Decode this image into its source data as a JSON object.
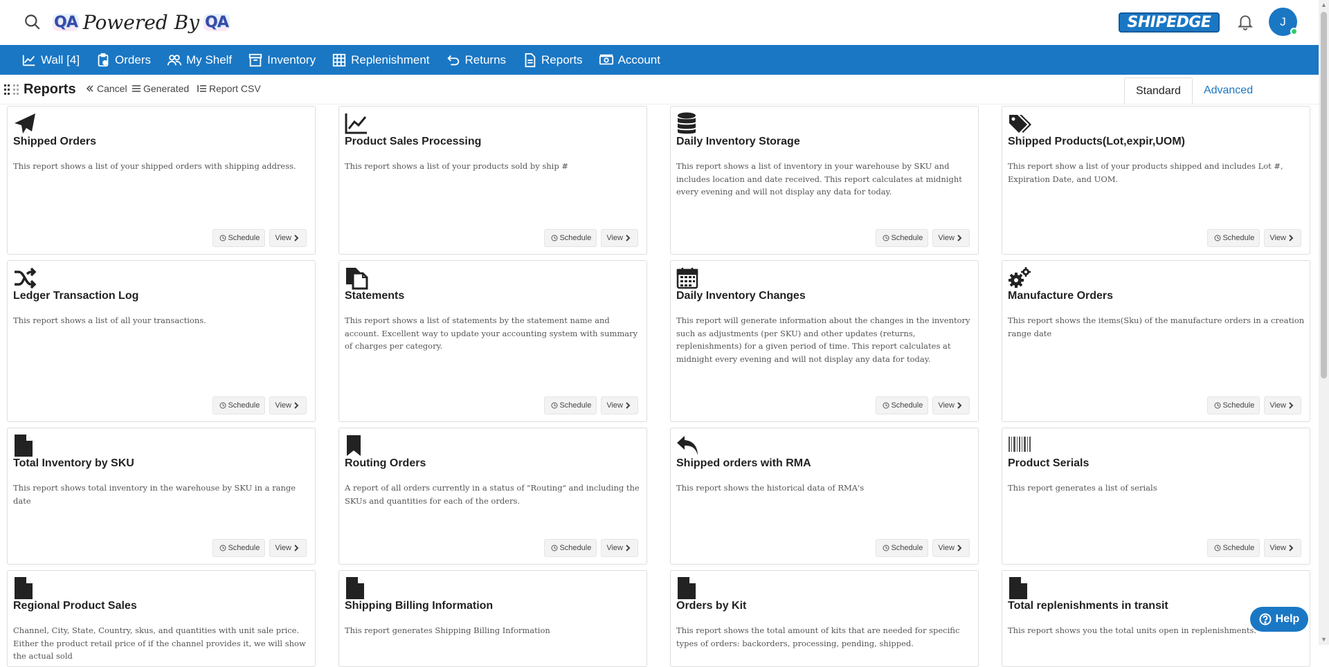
{
  "header": {
    "brand_left": "QA",
    "brand_middle": "Powered By",
    "brand_right": "QA",
    "logo_text": "SHIPEDGE",
    "avatar_initial": "J"
  },
  "nav": [
    {
      "label": "Wall [4]",
      "icon": "chart-line-icon"
    },
    {
      "label": "Orders",
      "icon": "clipboard-icon"
    },
    {
      "label": "My Shelf",
      "icon": "users-icon"
    },
    {
      "label": "Inventory",
      "icon": "archive-box-icon"
    },
    {
      "label": "Replenishment",
      "icon": "grid-icon"
    },
    {
      "label": "Returns",
      "icon": "undo-icon"
    },
    {
      "label": "Reports",
      "icon": "document-icon"
    },
    {
      "label": "Account",
      "icon": "money-icon"
    }
  ],
  "subheader": {
    "title": "Reports",
    "cancel": "Cancel",
    "generated": "Generated",
    "report_csv": "Report CSV",
    "tab_standard": "Standard",
    "tab_advanced": "Advanced"
  },
  "actions": {
    "schedule": "Schedule",
    "view": "View"
  },
  "reports": [
    {
      "title": "Shipped Orders",
      "icon": "paper-plane-icon",
      "desc": "This report shows a list of your shipped orders with shipping address."
    },
    {
      "title": "Product Sales Processing",
      "icon": "chart-line-icon",
      "desc": "This report shows a list of your products sold by ship #"
    },
    {
      "title": "Daily Inventory Storage",
      "icon": "database-icon",
      "desc": "This report shows a list of inventory in your warehouse by SKU and includes location and date received. This report calculates at midnight every evening and will not display any data for today."
    },
    {
      "title": "Shipped Products(Lot,expir,UOM)",
      "icon": "tags-icon",
      "desc": "This report show a list of your products shipped and includes Lot #, Expiration Date, and UOM."
    },
    {
      "title": "Ledger Transaction Log",
      "icon": "shuffle-icon",
      "desc": "This report shows a list of all your transactions."
    },
    {
      "title": "Statements",
      "icon": "copy-icon",
      "desc": "This report shows a list of statements by the statement name and account. Excellent way to update your accounting system with summary of charges per category."
    },
    {
      "title": "Daily Inventory Changes",
      "icon": "calendar-icon",
      "desc": "This report will generate information about the changes in the inventory such as adjustments (per SKU) and other updates (returns, replenishments) for a given period of time. This report calculates at midnight every evening and will not display any data for today."
    },
    {
      "title": "Manufacture Orders",
      "icon": "gears-icon",
      "desc": "This report shows the items(Sku) of the manufacture orders in a creation range date"
    },
    {
      "title": "Total Inventory by SKU",
      "icon": "file-icon",
      "desc": "This report shows total inventory in the warehouse by SKU in a range date"
    },
    {
      "title": "Routing Orders",
      "icon": "bookmark-icon",
      "desc": "A report of all orders currently in a status of \"Routing\" and including the SKUs and quantities for each of the orders."
    },
    {
      "title": "Shipped orders with RMA",
      "icon": "reply-icon",
      "desc": "This report shows the historical data of RMA's"
    },
    {
      "title": "Product Serials",
      "icon": "barcode-icon",
      "desc": "This report generates a list of serials"
    },
    {
      "title": "Regional Product Sales",
      "icon": "file-icon",
      "desc": "Channel, City, State, Country, skus, and quantities with unit sale price. Either the product retail price of if the channel provides it, we will show the actual sold"
    },
    {
      "title": "Shipping Billing Information",
      "icon": "file-icon",
      "desc": "This report generates Shipping Billing Information"
    },
    {
      "title": "Orders by Kit",
      "icon": "file-icon",
      "desc": "This report shows the total amount of kits that are needed for specific types of orders: backorders, processing, pending, shipped."
    },
    {
      "title": "Total replenishments in transit",
      "icon": "file-icon",
      "desc": "This report shows you the total units open in replenishments."
    }
  ],
  "help": {
    "label": "Help"
  },
  "colors": {
    "primary": "#1a77c4",
    "avatar_status": "#2ecc71"
  }
}
